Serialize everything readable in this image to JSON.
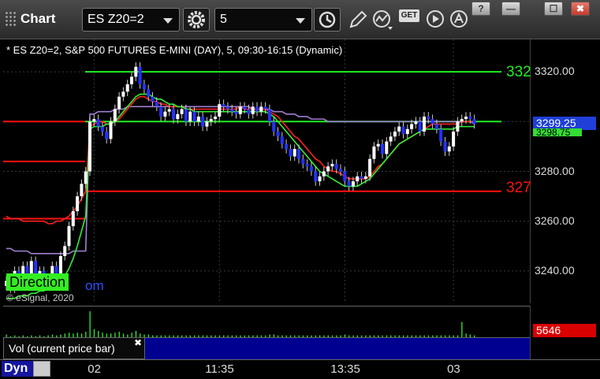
{
  "toolbar": {
    "title": "Chart",
    "symbol_value": "ES Z20=2",
    "interval_value": "5",
    "get_label": "GET",
    "help_label": "?",
    "restore_label": "—",
    "maximize_label": "☐",
    "close_label": "✖"
  },
  "chart_info": "* ES Z20=2, S&P 500 FUTURES E-MINI (DAY), 5, 09:30-16:15 (Dynamic)",
  "last_price": "3299.25",
  "ma_price": "3298.75",
  "high_line_label": "332",
  "low_line_label": "327",
  "direction_label": "Direction",
  "direction_suffix": "om",
  "copyright": "© eSignal, 2020",
  "volume": {
    "legend": "Vol (current price bar)",
    "close_label": "✖",
    "last_value": "5646"
  },
  "time_axis": {
    "dyn_label": "Dyn"
  },
  "colors": {
    "up_bar": "#ffffff",
    "down_bar": "#2233ff",
    "ma_red": "#ff2020",
    "ma_green": "#33ee33",
    "ma_purple": "#a080d0",
    "level_green": "#22ee22",
    "level_red": "#ff1010",
    "last_price_tag": "#1f3fd8",
    "vol_tag": "#d80000"
  },
  "chart_data": {
    "type": "candlestick",
    "ylim": [
      3227,
      3333
    ],
    "yticks": [
      "3320.00",
      "3300.00",
      "3280.00",
      "3260.00",
      "3240.00"
    ],
    "ytick_values": [
      3320,
      3300,
      3280,
      3260,
      3240
    ],
    "xticks": [
      "02",
      "11:35",
      "13:35",
      "03"
    ],
    "xtick_index": [
      21,
      51,
      81,
      107
    ],
    "levels": [
      {
        "value": 3320,
        "color": "#22ee22",
        "label": "332"
      },
      {
        "value": 3272,
        "color": "#ff1010",
        "label": "327"
      },
      {
        "value": 3300,
        "color": "#ff1010",
        "label": ""
      },
      {
        "value": 3300,
        "color": "#22ee22",
        "label": ""
      },
      {
        "value": 3284,
        "color": "#ff1010",
        "label": ""
      },
      {
        "value": 3261,
        "color": "#ff1010",
        "label": ""
      }
    ],
    "closes": [
      3236,
      3233,
      3240,
      3238,
      3242,
      3236,
      3244,
      3238,
      3240,
      3234,
      3236,
      3242,
      3238,
      3246,
      3250,
      3258,
      3264,
      3270,
      3275,
      3280,
      3300,
      3301,
      3298,
      3296,
      3293,
      3300,
      3305,
      3310,
      3312,
      3315,
      3318,
      3322,
      3315,
      3313,
      3310,
      3308,
      3306,
      3302,
      3304,
      3305,
      3301,
      3303,
      3305,
      3300,
      3304,
      3300,
      3302,
      3298,
      3300,
      3301,
      3302,
      3307,
      3306,
      3305,
      3304,
      3303,
      3306,
      3305,
      3303,
      3306,
      3304,
      3306,
      3305,
      3300,
      3296,
      3294,
      3291,
      3289,
      3286,
      3289,
      3285,
      3283,
      3282,
      3280,
      3276,
      3278,
      3280,
      3282,
      3283,
      3281,
      3280,
      3276,
      3274,
      3276,
      3278,
      3277,
      3278,
      3285,
      3290,
      3291,
      3287,
      3292,
      3294,
      3296,
      3298,
      3295,
      3297,
      3299,
      3300,
      3296,
      3302,
      3301,
      3299,
      3297,
      3292,
      3288,
      3290,
      3296,
      3300,
      3301,
      3302,
      3301,
      3299
    ],
    "ma_red": [
      3262,
      3261,
      3261,
      3261,
      3260,
      3260,
      3260,
      3260,
      3260,
      3260,
      3259,
      3259,
      3260,
      3260,
      3261,
      3262,
      3264,
      3266,
      3269,
      3272,
      3298,
      3299,
      3300,
      3300,
      3299,
      3299,
      3300,
      3301,
      3303,
      3305,
      3307,
      3309,
      3310,
      3310,
      3309,
      3308,
      3308,
      3307,
      3307,
      3306,
      3306,
      3306,
      3306,
      3305,
      3305,
      3305,
      3305,
      3305,
      3305,
      3305,
      3305,
      3305,
      3305,
      3305,
      3305,
      3305,
      3306,
      3305,
      3305,
      3305,
      3305,
      3305,
      3305,
      3304,
      3303,
      3302,
      3300,
      3298,
      3296,
      3294,
      3293,
      3291,
      3289,
      3287,
      3285,
      3284,
      3282,
      3281,
      3280,
      3280,
      3279,
      3278,
      3277,
      3277,
      3277,
      3277,
      3277,
      3278,
      3280,
      3282,
      3283,
      3285,
      3287,
      3289,
      3291,
      3292,
      3293,
      3294,
      3295,
      3296,
      3297,
      3298,
      3299,
      3299,
      3299,
      3299,
      3299,
      3299,
      3299,
      3300,
      3300,
      3300,
      3300
    ],
    "ma_purple": [
      3249,
      3249,
      3248,
      3248,
      3248,
      3248,
      3247,
      3247,
      3247,
      3247,
      3247,
      3247,
      3247,
      3247,
      3247,
      3247,
      3248,
      3248,
      3248,
      3248,
      3303,
      3303,
      3304,
      3304,
      3304,
      3304,
      3305,
      3305,
      3305,
      3306,
      3306,
      3306,
      3306,
      3306,
      3306,
      3306,
      3306,
      3306,
      3306,
      3306,
      3306,
      3306,
      3306,
      3306,
      3306,
      3306,
      3306,
      3306,
      3306,
      3306,
      3306,
      3306,
      3306,
      3306,
      3306,
      3306,
      3306,
      3306,
      3306,
      3305,
      3305,
      3305,
      3305,
      3305,
      3304,
      3304,
      3304,
      3303,
      3303,
      3303,
      3302,
      3302,
      3302,
      3301,
      3301,
      3301,
      3301,
      3300,
      3300,
      3300,
      3300,
      3300,
      3300,
      3300,
      3300,
      3300,
      3300,
      3300,
      3300,
      3300,
      3300,
      3300,
      3300,
      3300,
      3300,
      3300,
      3300,
      3300,
      3300,
      3300,
      3300,
      3300,
      3300,
      3300,
      3300,
      3300,
      3300,
      3300,
      3300,
      3300,
      3300,
      3300,
      3299
    ],
    "ma_green": [
      3229,
      3229,
      3229,
      3230,
      3230,
      3230,
      3231,
      3231,
      3232,
      3232,
      3233,
      3234,
      3235,
      3236,
      3238,
      3241,
      3245,
      3250,
      3256,
      3262,
      3297,
      3298,
      3298,
      3298,
      3299,
      3299,
      3300,
      3302,
      3304,
      3306,
      3308,
      3310,
      3311,
      3311,
      3311,
      3310,
      3309,
      3309,
      3308,
      3307,
      3307,
      3306,
      3306,
      3305,
      3305,
      3304,
      3304,
      3304,
      3304,
      3304,
      3304,
      3304,
      3304,
      3304,
      3304,
      3304,
      3304,
      3304,
      3304,
      3304,
      3304,
      3304,
      3304,
      3303,
      3302,
      3300,
      3298,
      3296,
      3294,
      3292,
      3290,
      3288,
      3286,
      3284,
      3282,
      3280,
      3279,
      3278,
      3277,
      3276,
      3275,
      3274,
      3274,
      3274,
      3274,
      3275,
      3276,
      3277,
      3279,
      3281,
      3283,
      3285,
      3287,
      3289,
      3291,
      3292,
      3293,
      3294,
      3295,
      3296,
      3297,
      3297,
      3297,
      3297,
      3297,
      3297,
      3297,
      3297,
      3298,
      3298,
      3298,
      3298,
      3298
    ],
    "volume": [
      4,
      2,
      3,
      2,
      3,
      2,
      3,
      2,
      3,
      2,
      3,
      4,
      3,
      4,
      5,
      6,
      5,
      6,
      5,
      7,
      30,
      10,
      8,
      6,
      5,
      5,
      6,
      7,
      5,
      4,
      6,
      8,
      5,
      4,
      4,
      3,
      3,
      3,
      3,
      3,
      3,
      3,
      3,
      3,
      3,
      3,
      3,
      3,
      3,
      3,
      3,
      3,
      3,
      3,
      3,
      3,
      3,
      3,
      3,
      3,
      3,
      3,
      3,
      4,
      4,
      3,
      3,
      3,
      3,
      3,
      3,
      3,
      3,
      3,
      3,
      3,
      3,
      3,
      3,
      3,
      3,
      4,
      3,
      3,
      3,
      3,
      3,
      3,
      3,
      3,
      3,
      3,
      3,
      3,
      3,
      3,
      3,
      3,
      3,
      3,
      3,
      3,
      3,
      3,
      3,
      3,
      3,
      3,
      3,
      18,
      5,
      4,
      3
    ]
  }
}
